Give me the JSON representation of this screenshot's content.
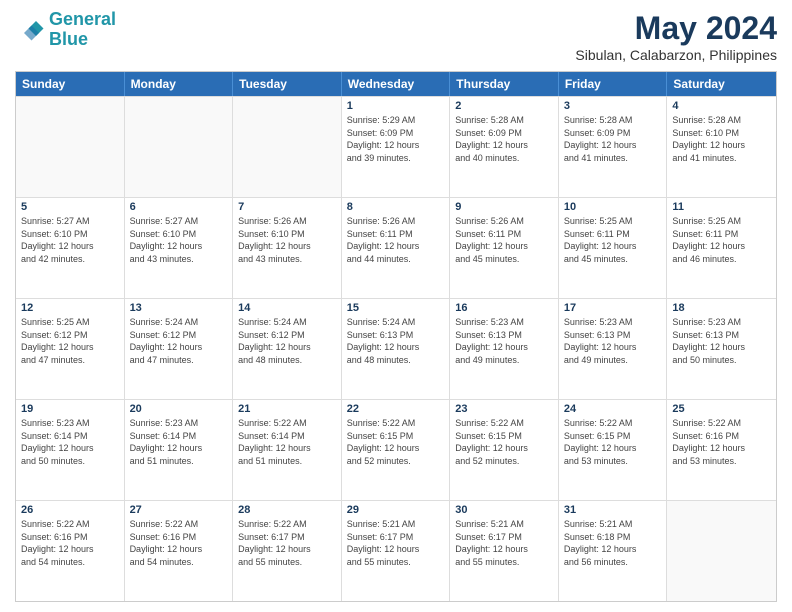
{
  "logo": {
    "line1": "General",
    "line2": "Blue"
  },
  "title": "May 2024",
  "subtitle": "Sibulan, Calabarzon, Philippines",
  "days": [
    "Sunday",
    "Monday",
    "Tuesday",
    "Wednesday",
    "Thursday",
    "Friday",
    "Saturday"
  ],
  "weeks": [
    [
      {
        "day": "",
        "info": ""
      },
      {
        "day": "",
        "info": ""
      },
      {
        "day": "",
        "info": ""
      },
      {
        "day": "1",
        "info": "Sunrise: 5:29 AM\nSunset: 6:09 PM\nDaylight: 12 hours\nand 39 minutes."
      },
      {
        "day": "2",
        "info": "Sunrise: 5:28 AM\nSunset: 6:09 PM\nDaylight: 12 hours\nand 40 minutes."
      },
      {
        "day": "3",
        "info": "Sunrise: 5:28 AM\nSunset: 6:09 PM\nDaylight: 12 hours\nand 41 minutes."
      },
      {
        "day": "4",
        "info": "Sunrise: 5:28 AM\nSunset: 6:10 PM\nDaylight: 12 hours\nand 41 minutes."
      }
    ],
    [
      {
        "day": "5",
        "info": "Sunrise: 5:27 AM\nSunset: 6:10 PM\nDaylight: 12 hours\nand 42 minutes."
      },
      {
        "day": "6",
        "info": "Sunrise: 5:27 AM\nSunset: 6:10 PM\nDaylight: 12 hours\nand 43 minutes."
      },
      {
        "day": "7",
        "info": "Sunrise: 5:26 AM\nSunset: 6:10 PM\nDaylight: 12 hours\nand 43 minutes."
      },
      {
        "day": "8",
        "info": "Sunrise: 5:26 AM\nSunset: 6:11 PM\nDaylight: 12 hours\nand 44 minutes."
      },
      {
        "day": "9",
        "info": "Sunrise: 5:26 AM\nSunset: 6:11 PM\nDaylight: 12 hours\nand 45 minutes."
      },
      {
        "day": "10",
        "info": "Sunrise: 5:25 AM\nSunset: 6:11 PM\nDaylight: 12 hours\nand 45 minutes."
      },
      {
        "day": "11",
        "info": "Sunrise: 5:25 AM\nSunset: 6:11 PM\nDaylight: 12 hours\nand 46 minutes."
      }
    ],
    [
      {
        "day": "12",
        "info": "Sunrise: 5:25 AM\nSunset: 6:12 PM\nDaylight: 12 hours\nand 47 minutes."
      },
      {
        "day": "13",
        "info": "Sunrise: 5:24 AM\nSunset: 6:12 PM\nDaylight: 12 hours\nand 47 minutes."
      },
      {
        "day": "14",
        "info": "Sunrise: 5:24 AM\nSunset: 6:12 PM\nDaylight: 12 hours\nand 48 minutes."
      },
      {
        "day": "15",
        "info": "Sunrise: 5:24 AM\nSunset: 6:13 PM\nDaylight: 12 hours\nand 48 minutes."
      },
      {
        "day": "16",
        "info": "Sunrise: 5:23 AM\nSunset: 6:13 PM\nDaylight: 12 hours\nand 49 minutes."
      },
      {
        "day": "17",
        "info": "Sunrise: 5:23 AM\nSunset: 6:13 PM\nDaylight: 12 hours\nand 49 minutes."
      },
      {
        "day": "18",
        "info": "Sunrise: 5:23 AM\nSunset: 6:13 PM\nDaylight: 12 hours\nand 50 minutes."
      }
    ],
    [
      {
        "day": "19",
        "info": "Sunrise: 5:23 AM\nSunset: 6:14 PM\nDaylight: 12 hours\nand 50 minutes."
      },
      {
        "day": "20",
        "info": "Sunrise: 5:23 AM\nSunset: 6:14 PM\nDaylight: 12 hours\nand 51 minutes."
      },
      {
        "day": "21",
        "info": "Sunrise: 5:22 AM\nSunset: 6:14 PM\nDaylight: 12 hours\nand 51 minutes."
      },
      {
        "day": "22",
        "info": "Sunrise: 5:22 AM\nSunset: 6:15 PM\nDaylight: 12 hours\nand 52 minutes."
      },
      {
        "day": "23",
        "info": "Sunrise: 5:22 AM\nSunset: 6:15 PM\nDaylight: 12 hours\nand 52 minutes."
      },
      {
        "day": "24",
        "info": "Sunrise: 5:22 AM\nSunset: 6:15 PM\nDaylight: 12 hours\nand 53 minutes."
      },
      {
        "day": "25",
        "info": "Sunrise: 5:22 AM\nSunset: 6:16 PM\nDaylight: 12 hours\nand 53 minutes."
      }
    ],
    [
      {
        "day": "26",
        "info": "Sunrise: 5:22 AM\nSunset: 6:16 PM\nDaylight: 12 hours\nand 54 minutes."
      },
      {
        "day": "27",
        "info": "Sunrise: 5:22 AM\nSunset: 6:16 PM\nDaylight: 12 hours\nand 54 minutes."
      },
      {
        "day": "28",
        "info": "Sunrise: 5:22 AM\nSunset: 6:17 PM\nDaylight: 12 hours\nand 55 minutes."
      },
      {
        "day": "29",
        "info": "Sunrise: 5:21 AM\nSunset: 6:17 PM\nDaylight: 12 hours\nand 55 minutes."
      },
      {
        "day": "30",
        "info": "Sunrise: 5:21 AM\nSunset: 6:17 PM\nDaylight: 12 hours\nand 55 minutes."
      },
      {
        "day": "31",
        "info": "Sunrise: 5:21 AM\nSunset: 6:18 PM\nDaylight: 12 hours\nand 56 minutes."
      },
      {
        "day": "",
        "info": ""
      }
    ]
  ]
}
